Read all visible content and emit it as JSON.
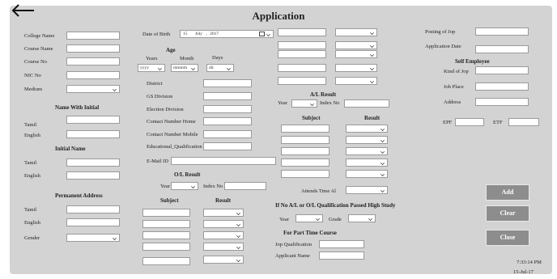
{
  "header": {
    "title": "Application"
  },
  "col1": {
    "fields": [
      "College Name",
      "Course Name",
      "Course No",
      "NIC No"
    ],
    "medium_label": "Medium",
    "name_with_initial_heading": "Name With Initial",
    "tamil_label": "Tamil",
    "english_label": "English",
    "initial_name_heading": "Initial Name",
    "tamil2_label": "Tamil",
    "english2_label": "English",
    "permanent_address_heading": "Permanent Address",
    "tamil3_label": "Tamil",
    "english3_label": "English",
    "gender_label": "Gender"
  },
  "col2": {
    "dob_label": "Date of Birth",
    "dob_day": "15",
    "dob_month": "July",
    "dob_year": "2017",
    "age_heading": "Age",
    "years_label": "Years",
    "month_label": "Month",
    "days_label": "Days",
    "years_value": "yyyy",
    "month_value": "mmmm",
    "days_value": "dd",
    "fields": [
      "District",
      "GS Division",
      "Election Division",
      "Contact Number Home",
      "Contact Number Mobile",
      "Educational_Qualification"
    ],
    "email_label": "E-Mail ID",
    "ol_heading": "O/L  Result",
    "year_label": "Year",
    "index_label": "Index No",
    "subject_heading": "Subject",
    "result_heading": "Result"
  },
  "col3": {
    "al_heading": "A/L Result",
    "year_label": "Year",
    "index_label": "Index No",
    "subject_heading": "Subject",
    "result_heading": "Result",
    "attempts_label": "Attends Time Al",
    "no_al_heading": "If No A/L or O/L  Qualification Passed High Study",
    "year2_label": "Year",
    "grade_label": "Grade",
    "part_time_heading": "For Part Time Course",
    "job_qual_label": "Jop Qualification",
    "applicant_label": "Applicant Name"
  },
  "col4": {
    "posting_label": "Posting of Jop",
    "app_date_label": "Application Date",
    "self_employee_heading": "Self Employee",
    "kind_label": "Kind of Jop",
    "place_label": "Job Place",
    "address_label": "Address",
    "epf_label": "EPF",
    "etf_label": "ETF"
  },
  "buttons": {
    "add": "Add",
    "clear": "Clear",
    "close": "Close"
  },
  "status": {
    "time": "7:33:14 PM",
    "date": "15-Jul-17"
  }
}
